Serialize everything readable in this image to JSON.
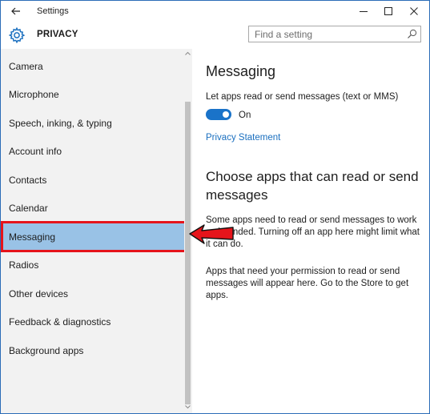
{
  "window": {
    "title": "Settings"
  },
  "header": {
    "section_title": "PRIVACY",
    "search_placeholder": "Find a setting"
  },
  "sidebar": {
    "items": [
      {
        "label": "Camera"
      },
      {
        "label": "Microphone"
      },
      {
        "label": "Speech, inking, & typing"
      },
      {
        "label": "Account info"
      },
      {
        "label": "Contacts"
      },
      {
        "label": "Calendar"
      },
      {
        "label": "Messaging",
        "selected": true
      },
      {
        "label": "Radios"
      },
      {
        "label": "Other devices"
      },
      {
        "label": "Feedback & diagnostics"
      },
      {
        "label": "Background apps"
      }
    ]
  },
  "content": {
    "heading": "Messaging",
    "toggle_description": "Let apps read or send messages (text or MMS)",
    "toggle_state": "On",
    "privacy_link": "Privacy Statement",
    "subheading": "Choose apps that can read or send messages",
    "paragraph1": "Some apps need to read or send messages to work as intended. Turning off an app here might limit what it can do.",
    "paragraph2": "Apps that need your permission to read or send messages will appear here. Go to the Store to get apps."
  },
  "colors": {
    "accent": "#1a73c9",
    "selected_bg": "#99c2e6",
    "highlight_border": "#e6141b",
    "sidebar_bg": "#f2f2f2"
  }
}
